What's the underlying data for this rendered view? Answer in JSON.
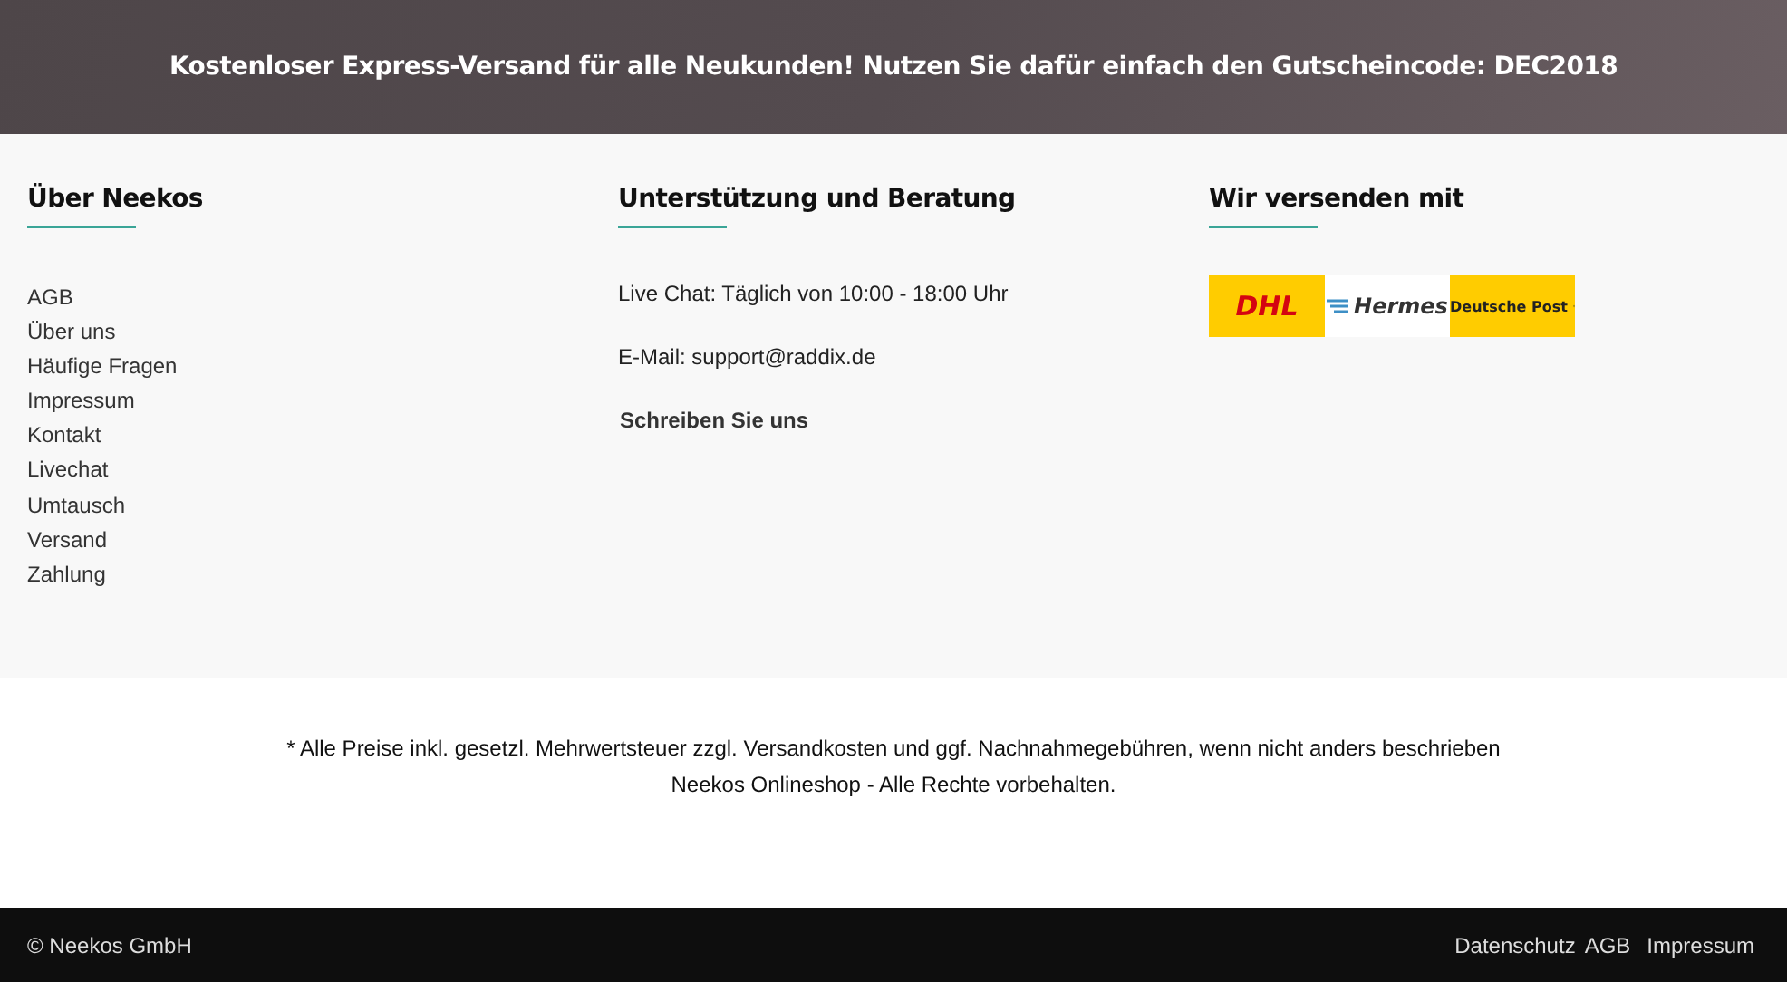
{
  "promo_banner": {
    "text": "Kostenloser Express-Versand für alle Neukunden! Nutzen Sie dafür einfach den Gutscheincode: DEC2018"
  },
  "footer_columns": [
    {
      "kind": "links",
      "title": "Über Neekos",
      "items": [
        "AGB",
        "Über uns",
        "Häufige Fragen",
        "Impressum",
        "Kontakt",
        "Livechat",
        "Umtausch",
        "Versand",
        "Zahlung"
      ]
    },
    {
      "kind": "contact",
      "title": "Unterstützung und Beratung",
      "lines": [
        "Live Chat: Täglich von 10:00 - 18:00 Uhr",
        "E-Mail: support@raddix.de"
      ],
      "link": "Schreiben Sie uns"
    },
    {
      "kind": "carriers",
      "title": "Wir versenden mit",
      "carriers": [
        {
          "kind": "dhl",
          "name": "DHL"
        },
        {
          "kind": "hermes",
          "name": "Hermes"
        },
        {
          "kind": "post",
          "name": "Deutsche Post"
        }
      ]
    }
  ],
  "notice": [
    "* Alle Preise inkl. gesetzl. Mehrwertsteuer zzgl. Versandkosten und ggf. Nachnahmegebühren, wenn nicht anders beschrieben",
    "Neekos Onlineshop - Alle Rechte vorbehalten."
  ],
  "bottom_bar": {
    "copyright": "© Neekos GmbH",
    "links": [
      "Datenschutz",
      "AGB",
      "Impressum"
    ]
  }
}
